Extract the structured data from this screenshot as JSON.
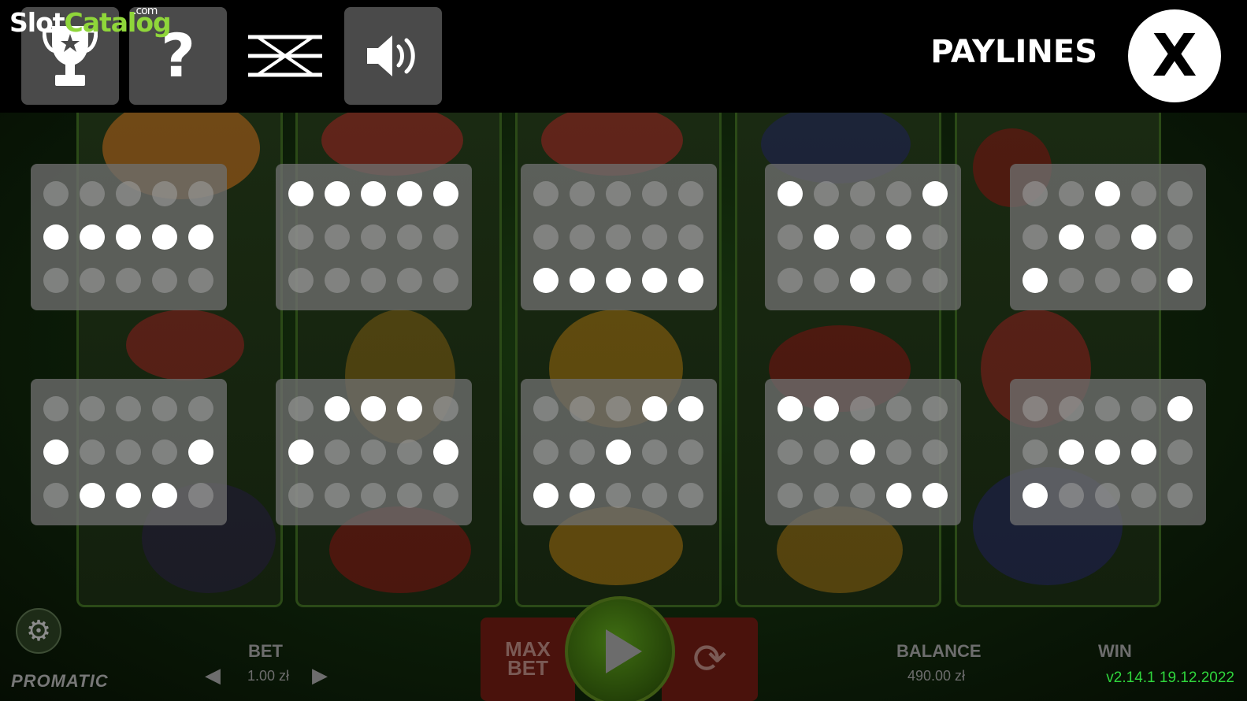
{
  "header": {
    "logo_text": "Slot",
    "logo_accent": "Catalog",
    "logo_suffix": ".com",
    "title": "PAYLINES",
    "close_label": "X",
    "help_label": "?"
  },
  "icons": {
    "trophy": "trophy-icon",
    "help": "question-mark-icon",
    "turbo": "crossed-lines-icon",
    "sound": "speaker-icon",
    "close": "close-icon",
    "settings": "gear-icon"
  },
  "paylines": [
    {
      "rows": [
        1,
        1,
        1,
        1,
        1
      ]
    },
    {
      "rows": [
        0,
        0,
        0,
        0,
        0
      ]
    },
    {
      "rows": [
        2,
        2,
        2,
        2,
        2
      ]
    },
    {
      "rows": [
        0,
        1,
        2,
        1,
        0
      ]
    },
    {
      "rows": [
        2,
        1,
        0,
        1,
        2
      ]
    },
    {
      "rows": [
        1,
        2,
        2,
        2,
        1
      ]
    },
    {
      "rows": [
        1,
        0,
        0,
        0,
        1
      ]
    },
    {
      "rows": [
        2,
        2,
        1,
        0,
        0
      ]
    },
    {
      "rows": [
        0,
        0,
        1,
        2,
        2
      ]
    },
    {
      "rows": [
        2,
        1,
        1,
        1,
        0
      ]
    }
  ],
  "bottom": {
    "brand": "PROMATIC",
    "bet_label": "BET",
    "bet_value": "1.00 zł",
    "max_bet_line1": "MAX",
    "max_bet_line2": "BET",
    "balance_label": "BALANCE",
    "balance_value": "490.00 zł",
    "win_label": "WIN",
    "version": "v2.14.1 19.12.2022"
  },
  "colors": {
    "accent_green": "#8fd63a",
    "version_green": "#2fd63c",
    "card_bg": "#6e6e6e",
    "dot_on": "#ffffff"
  }
}
